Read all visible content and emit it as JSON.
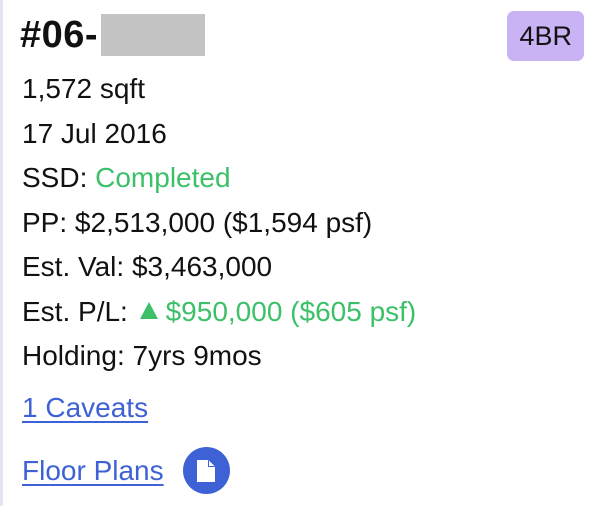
{
  "unit": {
    "number_prefix": "#06-",
    "bedroom_badge": "4BR"
  },
  "details": {
    "size": "1,572 sqft",
    "date": "17 Jul 2016",
    "ssd_label": "SSD:",
    "ssd_value": "Completed",
    "pp_label": "PP:",
    "pp_value": "$2,513,000 ($1,594 psf)",
    "est_val_label": "Est. Val:",
    "est_val_value": "$3,463,000",
    "est_pl_label": "Est. P/L:",
    "est_pl_value": "$950,000 ($605 psf)",
    "holding_label": "Holding:",
    "holding_value": "7yrs 9mos"
  },
  "links": {
    "caveats": "1 Caveats",
    "floor_plans": "Floor Plans"
  },
  "icons": {
    "profit_direction": "triangle-up-icon",
    "floor_plan_doc": "document-icon"
  },
  "colors": {
    "positive": "#3cc068",
    "link": "#3e62d6",
    "badge_bg": "#c9b3f5",
    "redacted": "#c4c4c4"
  }
}
